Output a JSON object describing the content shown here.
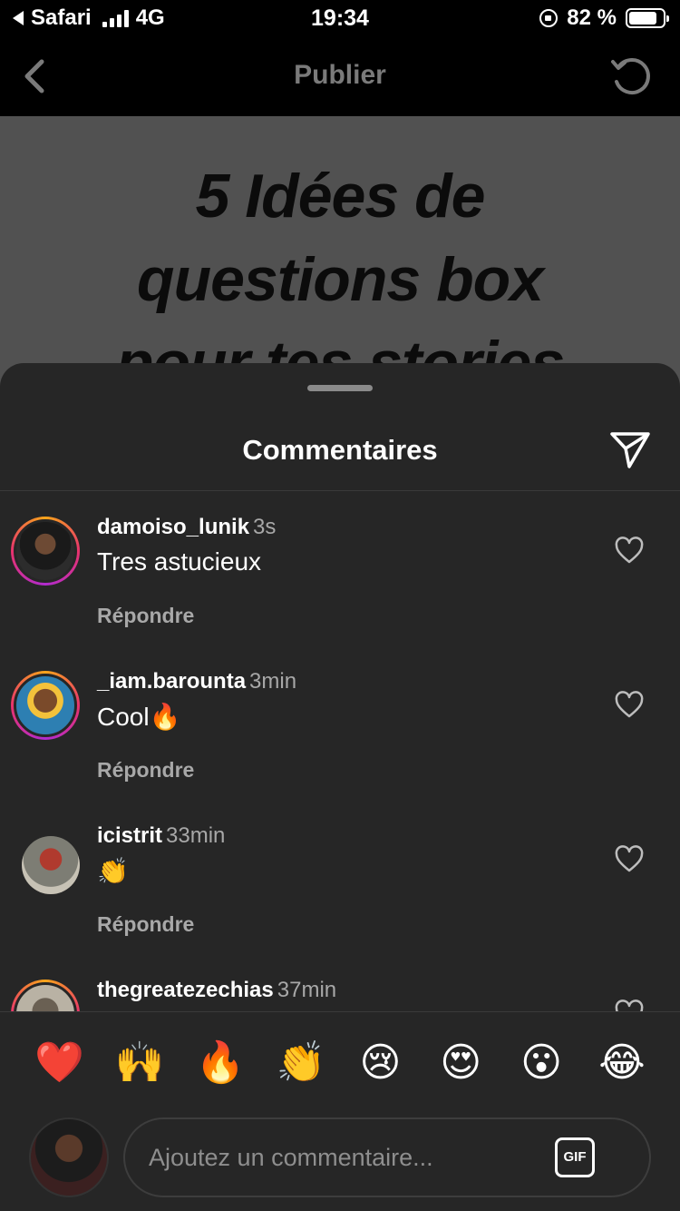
{
  "status_bar": {
    "back_app": "Safari",
    "network": "4G",
    "time": "19:34",
    "battery_percent": "82 %",
    "battery_level": 0.82
  },
  "header": {
    "title": "Publier"
  },
  "post": {
    "lines": [
      "5 Idées de",
      "questions box",
      "pour tes stories"
    ]
  },
  "sheet": {
    "title": "Commentaires"
  },
  "comments": [
    {
      "username": "damoiso_lunik",
      "time": "3s",
      "text": "Tres astucieux",
      "reply": "Répondre",
      "story_ring": true
    },
    {
      "username": "_iam.barounta",
      "time": "3min",
      "text": "Cool🔥",
      "reply": "Répondre",
      "story_ring": true
    },
    {
      "username": "icistrit",
      "time": "33min",
      "text": "👏",
      "reply": "Répondre",
      "story_ring": false
    },
    {
      "username": "thegreatezechias",
      "time": "37min",
      "text": "",
      "reply": "",
      "story_ring": true
    }
  ],
  "emoji_reactions": [
    "❤️",
    "🙌",
    "🔥",
    "👏",
    "😢",
    "😍",
    "😮",
    "😂"
  ],
  "composer": {
    "placeholder": "Ajoutez un commentaire...",
    "gif_label": "GIF"
  },
  "colors": {
    "background": "#000000",
    "sheet": "#262626",
    "secondary_text": "#a8a8a8",
    "story_ring": "#e8336d"
  }
}
